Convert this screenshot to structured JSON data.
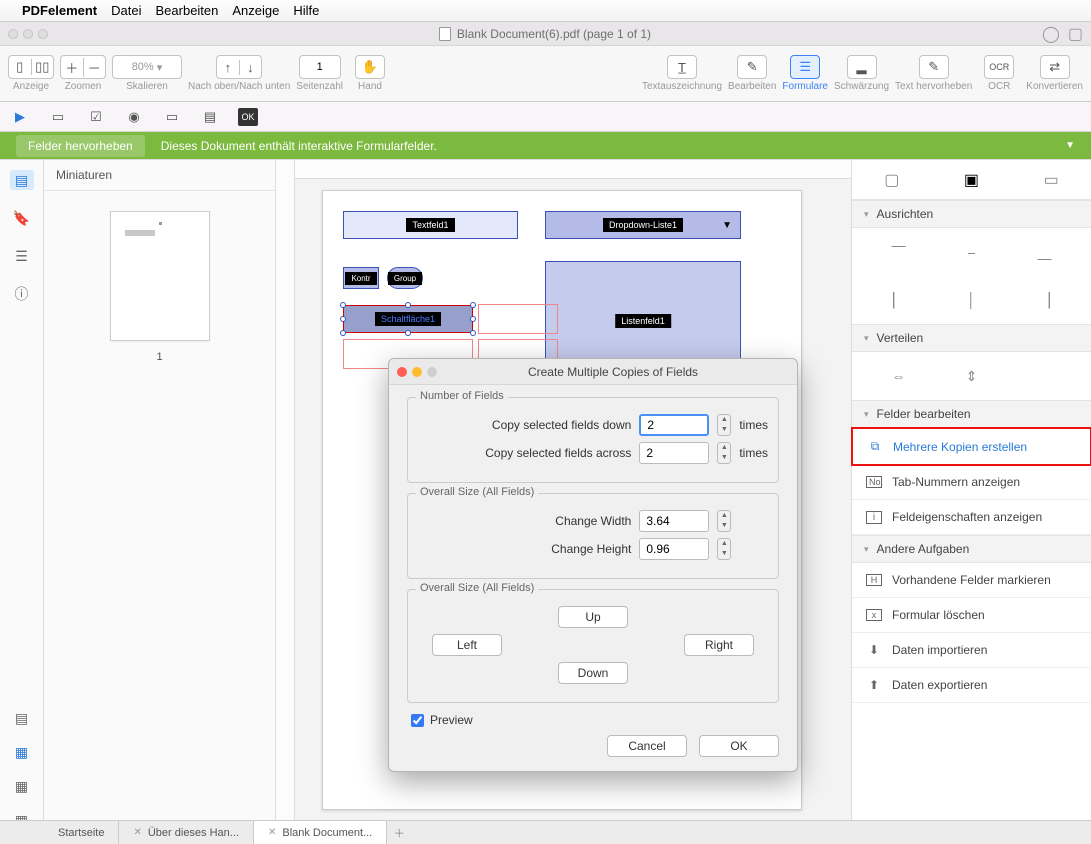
{
  "menubar": {
    "app": "PDFelement",
    "items": [
      "Datei",
      "Bearbeiten",
      "Anzeige",
      "Hilfe"
    ]
  },
  "window": {
    "title": "Blank Document(6).pdf (page 1 of 1)"
  },
  "toolbar": {
    "anzeige": "Anzeige",
    "zoomen": "Zoomen",
    "zoom_value": "80%",
    "skalieren": "Skalieren",
    "nachobenunten": "Nach oben/Nach unten",
    "page_value": "1",
    "seitenzahl": "Seitenzahl",
    "hand": "Hand",
    "textauszeichnung": "Textauszeichnung",
    "bearbeiten": "Bearbeiten",
    "formulare": "Formulare",
    "schwarzung": "Schwärzung",
    "texthervorheben": "Text hervorheben",
    "ocr": "OCR",
    "konvertieren": "Konvertieren"
  },
  "greenbar": {
    "pill": "Felder hervorheben",
    "text": "Dieses Dokument enthält interaktive Formularfelder."
  },
  "thumbnails": {
    "header": "Miniaturen",
    "page_label": "1"
  },
  "fields": {
    "textfeld": "Textfeld1",
    "dropdown": "Dropdown-Liste1",
    "kontr": "Kontr",
    "group": "Group",
    "schaltflache": "Schaltfläche1",
    "listenfeld": "Listenfeld1"
  },
  "rightpanel": {
    "ausrichten": "Ausrichten",
    "verteilen": "Verteilen",
    "felder_bearbeiten": "Felder bearbeiten",
    "mehrere_kopien": "Mehrere Kopien erstellen",
    "tab_nummern": "Tab-Nummern anzeigen",
    "feldeigenschaften": "Feldeigenschaften anzeigen",
    "andere_aufgaben": "Andere Aufgaben",
    "vorhandene_felder": "Vorhandene Felder markieren",
    "formular_loschen": "Formular löschen",
    "daten_importieren": "Daten importieren",
    "daten_exportieren": "Daten exportieren"
  },
  "tabs": {
    "start": "Startseite",
    "uber": "Über dieses Han...",
    "blank": "Blank Document..."
  },
  "modal": {
    "title": "Create Multiple Copies of Fields",
    "number_of_fields": "Number of Fields",
    "copy_down": "Copy selected fields down",
    "copy_down_value": "2",
    "copy_across": "Copy selected fields across",
    "copy_across_value": "2",
    "times": "times",
    "overall_size": "Overall Size (All Fields)",
    "change_width": "Change Width",
    "change_width_value": "3.64",
    "change_height": "Change Height",
    "change_height_value": "0.96",
    "up": "Up",
    "left": "Left",
    "right": "Right",
    "down": "Down",
    "preview": "Preview",
    "cancel": "Cancel",
    "ok": "OK"
  }
}
